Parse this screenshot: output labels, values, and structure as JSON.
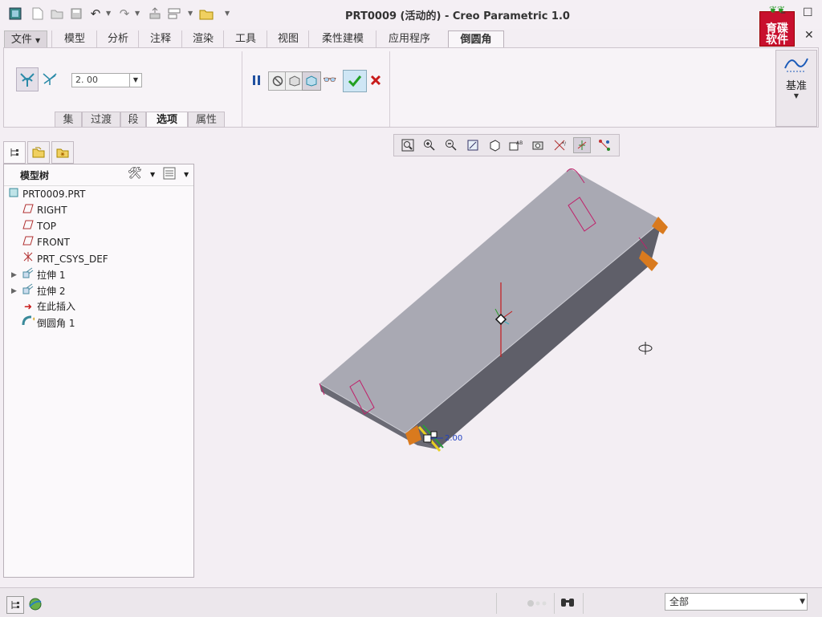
{
  "window": {
    "title": "PRT0009 (活动的) - Creo Parametric 1.0",
    "logo_line1": "育碟",
    "logo_line2": "软件"
  },
  "ribbon_tabs": [
    {
      "label": "文件",
      "file": true
    },
    {
      "label": "模型"
    },
    {
      "label": "分析"
    },
    {
      "label": "注释"
    },
    {
      "label": "渲染"
    },
    {
      "label": "工具"
    },
    {
      "label": "视图"
    },
    {
      "label": "柔性建模"
    },
    {
      "label": "应用程序"
    },
    {
      "label": "倒圆角",
      "active": true
    }
  ],
  "round_tool": {
    "radius_value": "2. 00",
    "subtabs": [
      {
        "label": "集"
      },
      {
        "label": "过渡"
      },
      {
        "label": "段"
      },
      {
        "label": "选项",
        "active": true
      },
      {
        "label": "属性"
      }
    ],
    "datum_label": "基准"
  },
  "model_tree": {
    "title": "模型树",
    "items": [
      {
        "label": "PRT0009.PRT",
        "icon": "part-icon"
      },
      {
        "label": "RIGHT",
        "icon": "datum-plane-icon"
      },
      {
        "label": "TOP",
        "icon": "datum-plane-icon"
      },
      {
        "label": "FRONT",
        "icon": "datum-plane-icon"
      },
      {
        "label": "PRT_CSYS_DEF",
        "icon": "csys-icon"
      },
      {
        "label": "拉伸 1",
        "icon": "extrude-icon",
        "expandable": true
      },
      {
        "label": "拉伸 2",
        "icon": "extrude-icon",
        "expandable": true
      },
      {
        "label": "在此插入",
        "icon": "insert-here-arrow-icon"
      },
      {
        "label": "倒圆角 1",
        "icon": "round-icon"
      }
    ]
  },
  "viewport": {
    "dimension_label": "2.00"
  },
  "status": {
    "filter_value": "全部"
  },
  "colors": {
    "background": "#f3eef3",
    "part_top": "#a9a9b3",
    "part_side": "#5d5d66",
    "accent_orange": "#d97a1e",
    "highlight_magenta": "#c0206a",
    "confirm_green": "#22a022",
    "cancel_red": "#c81a1a"
  }
}
